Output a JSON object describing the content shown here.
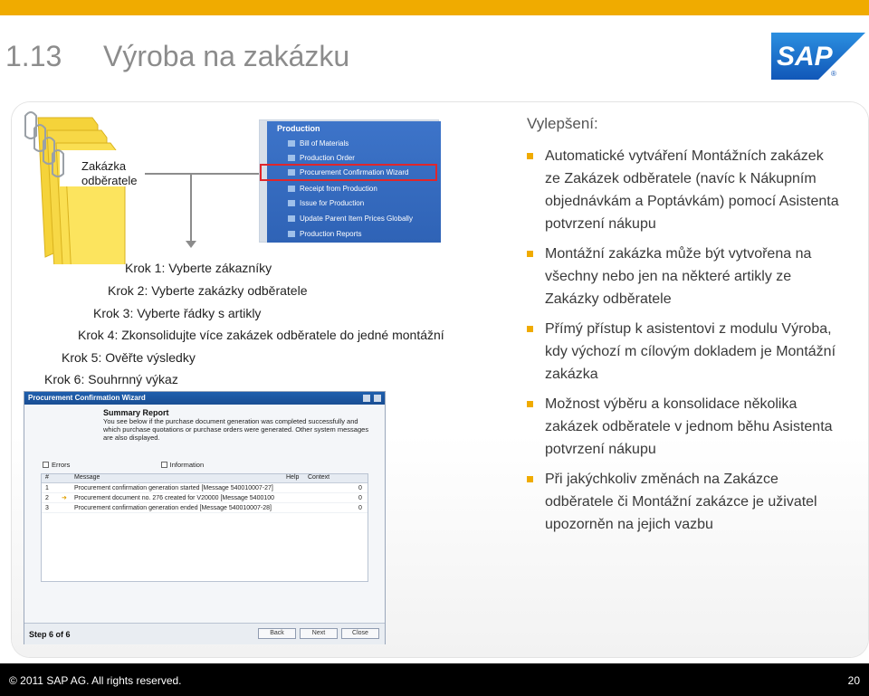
{
  "header": {
    "number": "1.13",
    "title": "Výroba na zakázku",
    "logo_text": "SAP"
  },
  "folder": {
    "label_line1": "Zakázka",
    "label_line2": "odběratele"
  },
  "menu": {
    "header": "Production",
    "items": [
      "Bill of Materials",
      "Production Order",
      "Procurement Confirmation Wizard",
      "Receipt from Production",
      "Issue for Production",
      "Update Parent Item Prices Globally",
      "Production Reports"
    ]
  },
  "steps": [
    "Krok 1: Vyberte zákazníky",
    "Krok 2: Vyberte zakázky odběratele",
    "Krok 3: Vyberte řádky s artikly",
    "Krok 4: Zkonsolidujte více zakázek odběratele do jedné montážní",
    "Krok 5: Ověřte výsledky",
    "Krok 6: Souhrnný výkaz"
  ],
  "wizard": {
    "title": "Procurement Confirmation Wizard",
    "heading": "Summary Report",
    "text_line1": "You see below if the purchase document generation was completed successfully and",
    "text_line2": "which purchase quotations or purchase orders were generated. Other system messages",
    "text_line3": "are also displayed.",
    "errors_label": "Errors",
    "information_label": "Information",
    "columns": [
      "#",
      "Message",
      "Help",
      "Context"
    ],
    "rows": [
      {
        "num": "1",
        "message": "Procurement confirmation generation started   [Message 540010007-27]",
        "help": "",
        "context": "0"
      },
      {
        "num": "2",
        "message": "Procurement document no. 276 created for V20000   [Message 5400100",
        "help": "",
        "context": "0"
      },
      {
        "num": "3",
        "message": "Procurement confirmation generation ended   [Message 540010007-28]",
        "help": "",
        "context": "0"
      }
    ],
    "step": "Step 6 of 6",
    "buttons": {
      "back": "Back",
      "next": "Next",
      "close": "Close"
    }
  },
  "improvements": {
    "title": "Vylepšení:",
    "bullets": [
      [
        "Automatické vytváření Montážních zakázek",
        "ze Zakázek odběratele (navíc k Nákupním",
        "objednávkám a Poptávkám) pomocí Asistenta",
        "potvrzení nákupu"
      ],
      [
        "Montážní zakázka může být vytvořena  na",
        "všechny nebo jen na některé artikly ze",
        "Zakázky odběratele"
      ],
      [
        "Přímý přístup k asistentovi z modulu Výroba,",
        "kdy výchozí m cílovým dokladem je  Montážní",
        "zakázka"
      ],
      [
        "Možnost výběru a konsolidace několika",
        "zakázek odběratele v jednom běhu Asistenta",
        "potvrzení nákupu"
      ],
      [
        "Při jakýchkoliv změnách na Zakázce",
        "odběratele či Montážní zakázce je uživatel",
        "upozorněn na jejich vazbu"
      ]
    ]
  },
  "footer": {
    "copyright": "© 2011 SAP AG. All rights reserved.",
    "page": "20"
  },
  "colors": {
    "accent": "#f0ab00",
    "sap_blue": "#1f6fc5",
    "highlight": "#e0262b"
  }
}
